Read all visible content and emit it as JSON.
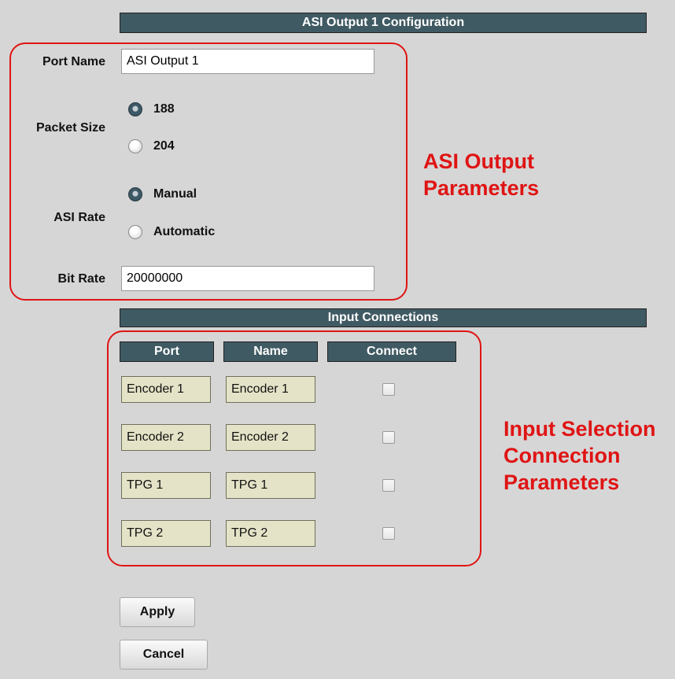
{
  "config_header": "ASI Output 1 Configuration",
  "port_name": {
    "label": "Port Name",
    "value": "ASI Output 1"
  },
  "packet_size": {
    "label": "Packet Size",
    "options": [
      {
        "label": "188",
        "selected": true
      },
      {
        "label": "204",
        "selected": false
      }
    ]
  },
  "asi_rate": {
    "label": "ASI Rate",
    "options": [
      {
        "label": "Manual",
        "selected": true
      },
      {
        "label": "Automatic",
        "selected": false
      }
    ]
  },
  "bit_rate": {
    "label": "Bit Rate",
    "value": "20000000"
  },
  "input_header": "Input Connections",
  "input_table": {
    "columns": [
      "Port",
      "Name",
      "Connect"
    ],
    "rows": [
      {
        "port": "Encoder 1",
        "name": "Encoder 1",
        "connected": false
      },
      {
        "port": "Encoder 2",
        "name": "Encoder 2",
        "connected": false
      },
      {
        "port": "TPG 1",
        "name": "TPG 1",
        "connected": false
      },
      {
        "port": "TPG 2",
        "name": "TPG 2",
        "connected": false
      }
    ]
  },
  "callouts": {
    "asi_output": [
      "ASI Output",
      "Parameters"
    ],
    "input_selection": [
      "Input Selection",
      "Connection",
      "Parameters"
    ]
  },
  "buttons": {
    "apply": "Apply",
    "cancel": "Cancel"
  },
  "colors": {
    "header_bg": "#405a63",
    "callout_red": "#e01414",
    "cell_bg": "#e5e3c7",
    "page_bg": "#d6d6d6"
  }
}
